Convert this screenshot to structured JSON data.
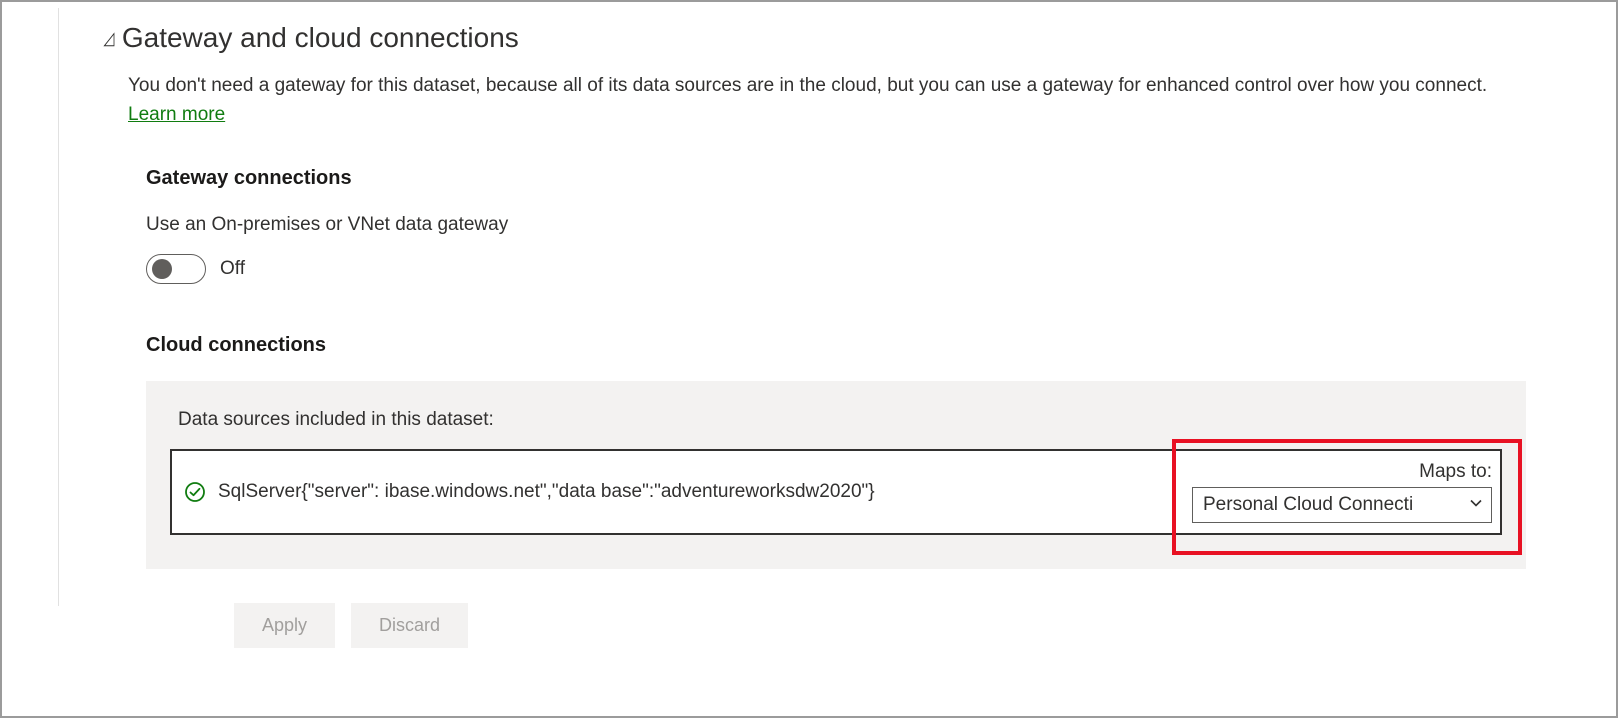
{
  "section": {
    "title": "Gateway and cloud connections",
    "description": "You don't need a gateway for this dataset, because all of its data sources are in the cloud, but you can use a gateway for enhanced control over how you connect. ",
    "learn_more": "Learn more"
  },
  "gateway": {
    "title": "Gateway connections",
    "label": "Use an On-premises or VNet data gateway",
    "toggle_state": "Off"
  },
  "cloud": {
    "title": "Cloud connections",
    "panel_label": "Data sources included in this dataset:",
    "datasource_text": "SqlServer{\"server\":                          ibase.windows.net\",\"data base\":\"adventureworksdw2020\"}",
    "maps_to_label": "Maps to:",
    "maps_to_value": "Personal Cloud Connecti"
  },
  "buttons": {
    "apply": "Apply",
    "discard": "Discard"
  }
}
